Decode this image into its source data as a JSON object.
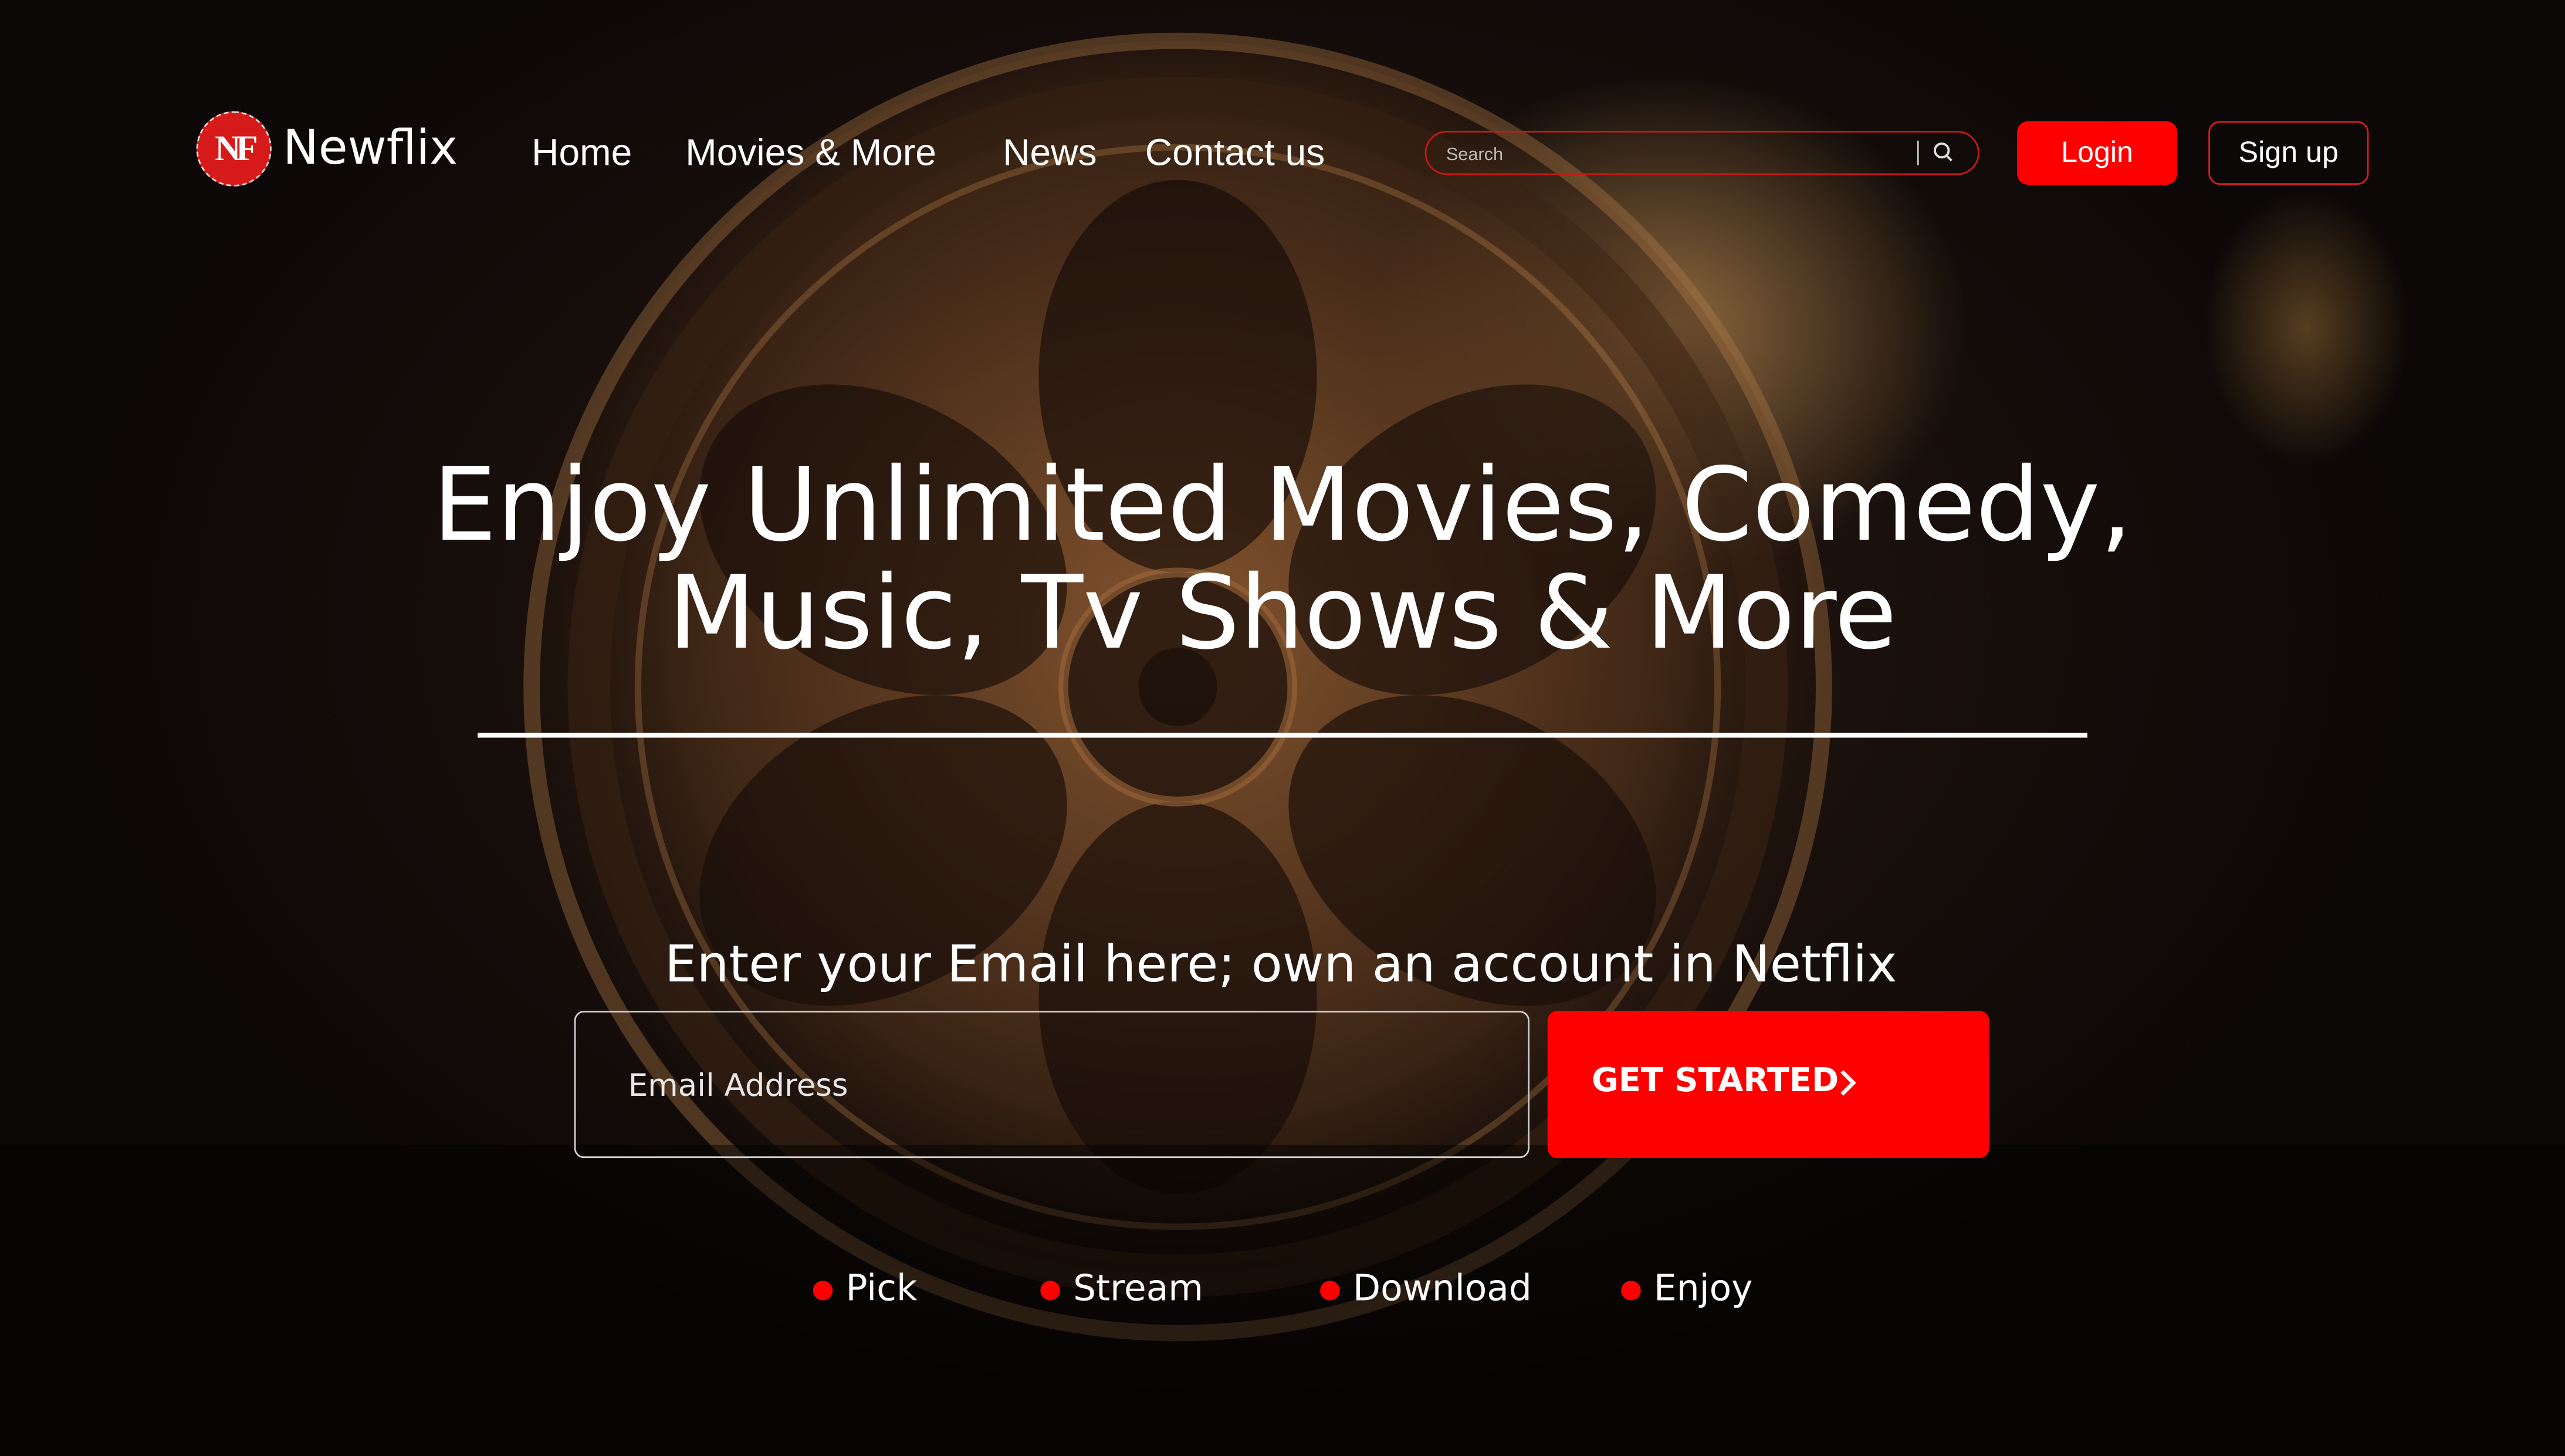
{
  "brand": {
    "name": "Newflix",
    "mark": "NF",
    "accent": "#ff0000"
  },
  "nav": [
    "Home",
    "Movies & More",
    "News",
    "Contact us"
  ],
  "search": {
    "placeholder": "Search",
    "icon": "search-icon"
  },
  "auth": {
    "login": "Login",
    "signup": "Sign up"
  },
  "hero": {
    "title_line1": "Enjoy Unlimited Movies, Comedy,",
    "title_line2": "Music, Tv Shows & More",
    "prompt": "Enter your Email here; own an account in Netflix",
    "email_placeholder": "Email Address",
    "cta": "GET STARTED",
    "cta_icon": "chevron-right-icon"
  },
  "steps": [
    "Pick",
    "Stream",
    "Download",
    "Enjoy"
  ],
  "background": "film-reel-photo"
}
